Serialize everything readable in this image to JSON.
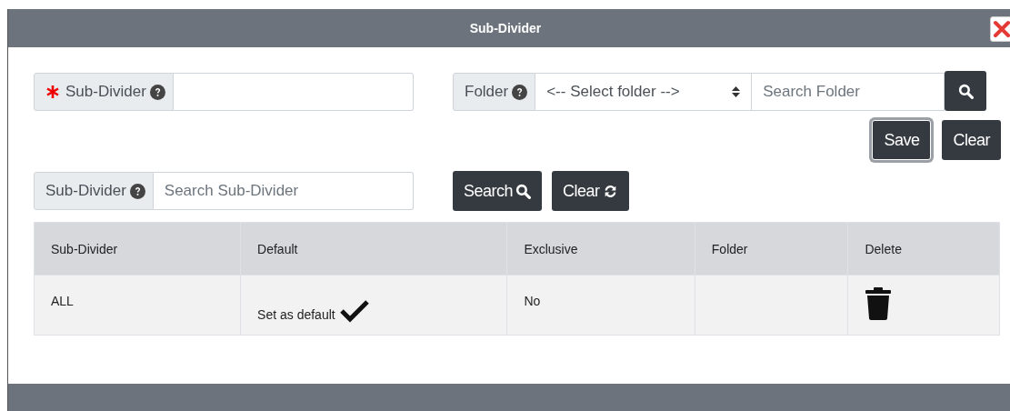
{
  "dialog": {
    "title": "Sub-Divider"
  },
  "form": {
    "name_field": {
      "label": "Sub-Divider",
      "required": true
    },
    "folder_field": {
      "label": "Folder",
      "select": "<-- Select folder -->",
      "placeholder": "Search Folder"
    },
    "actions": [
      {
        "label": "Save",
        "focused": true
      },
      {
        "label": "Clear",
        "focused": false
      }
    ]
  },
  "search": {
    "label": "Sub-Divider",
    "placeholder": "Search Sub-Divider",
    "buttons": [
      {
        "label": "Search",
        "kind": "search"
      },
      {
        "label": "Clear",
        "kind": "refresh"
      }
    ]
  },
  "table": {
    "columns": [
      "Sub-Divider",
      "Default",
      "Exclusive",
      "Folder",
      "Delete"
    ],
    "rows": [
      {
        "sub_divider": "ALL",
        "default": "Set as default",
        "is_default": true,
        "exclusive": "No"
      }
    ]
  }
}
